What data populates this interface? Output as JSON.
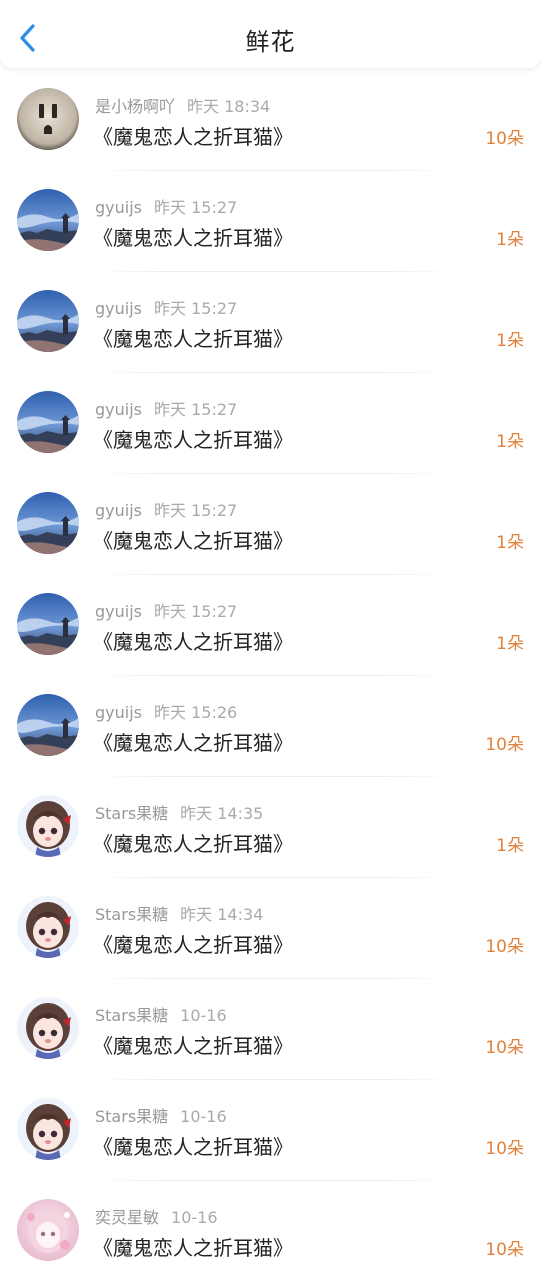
{
  "header": {
    "title": "鲜花",
    "back_icon": "chevron-left-icon",
    "accent": "#2a8de8"
  },
  "colors": {
    "count": "#e0823b",
    "username": "#999999"
  },
  "rows": [
    {
      "user": "是小杨啊吖",
      "time": "昨天 18:34",
      "book": "《魔鬼恋人之折耳猫》",
      "count": "10朵",
      "avatar": "outlet"
    },
    {
      "user": "gyuijs",
      "time": "昨天 15:27",
      "book": "《魔鬼恋人之折耳猫》",
      "count": "1朵",
      "avatar": "sky"
    },
    {
      "user": "gyuijs",
      "time": "昨天 15:27",
      "book": "《魔鬼恋人之折耳猫》",
      "count": "1朵",
      "avatar": "sky"
    },
    {
      "user": "gyuijs",
      "time": "昨天 15:27",
      "book": "《魔鬼恋人之折耳猫》",
      "count": "1朵",
      "avatar": "sky"
    },
    {
      "user": "gyuijs",
      "time": "昨天 15:27",
      "book": "《魔鬼恋人之折耳猫》",
      "count": "1朵",
      "avatar": "sky"
    },
    {
      "user": "gyuijs",
      "time": "昨天 15:27",
      "book": "《魔鬼恋人之折耳猫》",
      "count": "1朵",
      "avatar": "sky"
    },
    {
      "user": "gyuijs",
      "time": "昨天 15:26",
      "book": "《魔鬼恋人之折耳猫》",
      "count": "10朵",
      "avatar": "sky"
    },
    {
      "user": "Stars果糖",
      "time": "昨天 14:35",
      "book": "《魔鬼恋人之折耳猫》",
      "count": "1朵",
      "avatar": "anime"
    },
    {
      "user": "Stars果糖",
      "time": "昨天 14:34",
      "book": "《魔鬼恋人之折耳猫》",
      "count": "10朵",
      "avatar": "anime"
    },
    {
      "user": "Stars果糖",
      "time": "10-16",
      "book": "《魔鬼恋人之折耳猫》",
      "count": "10朵",
      "avatar": "anime"
    },
    {
      "user": "Stars果糖",
      "time": "10-16",
      "book": "《魔鬼恋人之折耳猫》",
      "count": "10朵",
      "avatar": "anime"
    },
    {
      "user": "奕灵星敏",
      "time": "10-16",
      "book": "《魔鬼恋人之折耳猫》",
      "count": "10朵",
      "avatar": "pink"
    }
  ]
}
